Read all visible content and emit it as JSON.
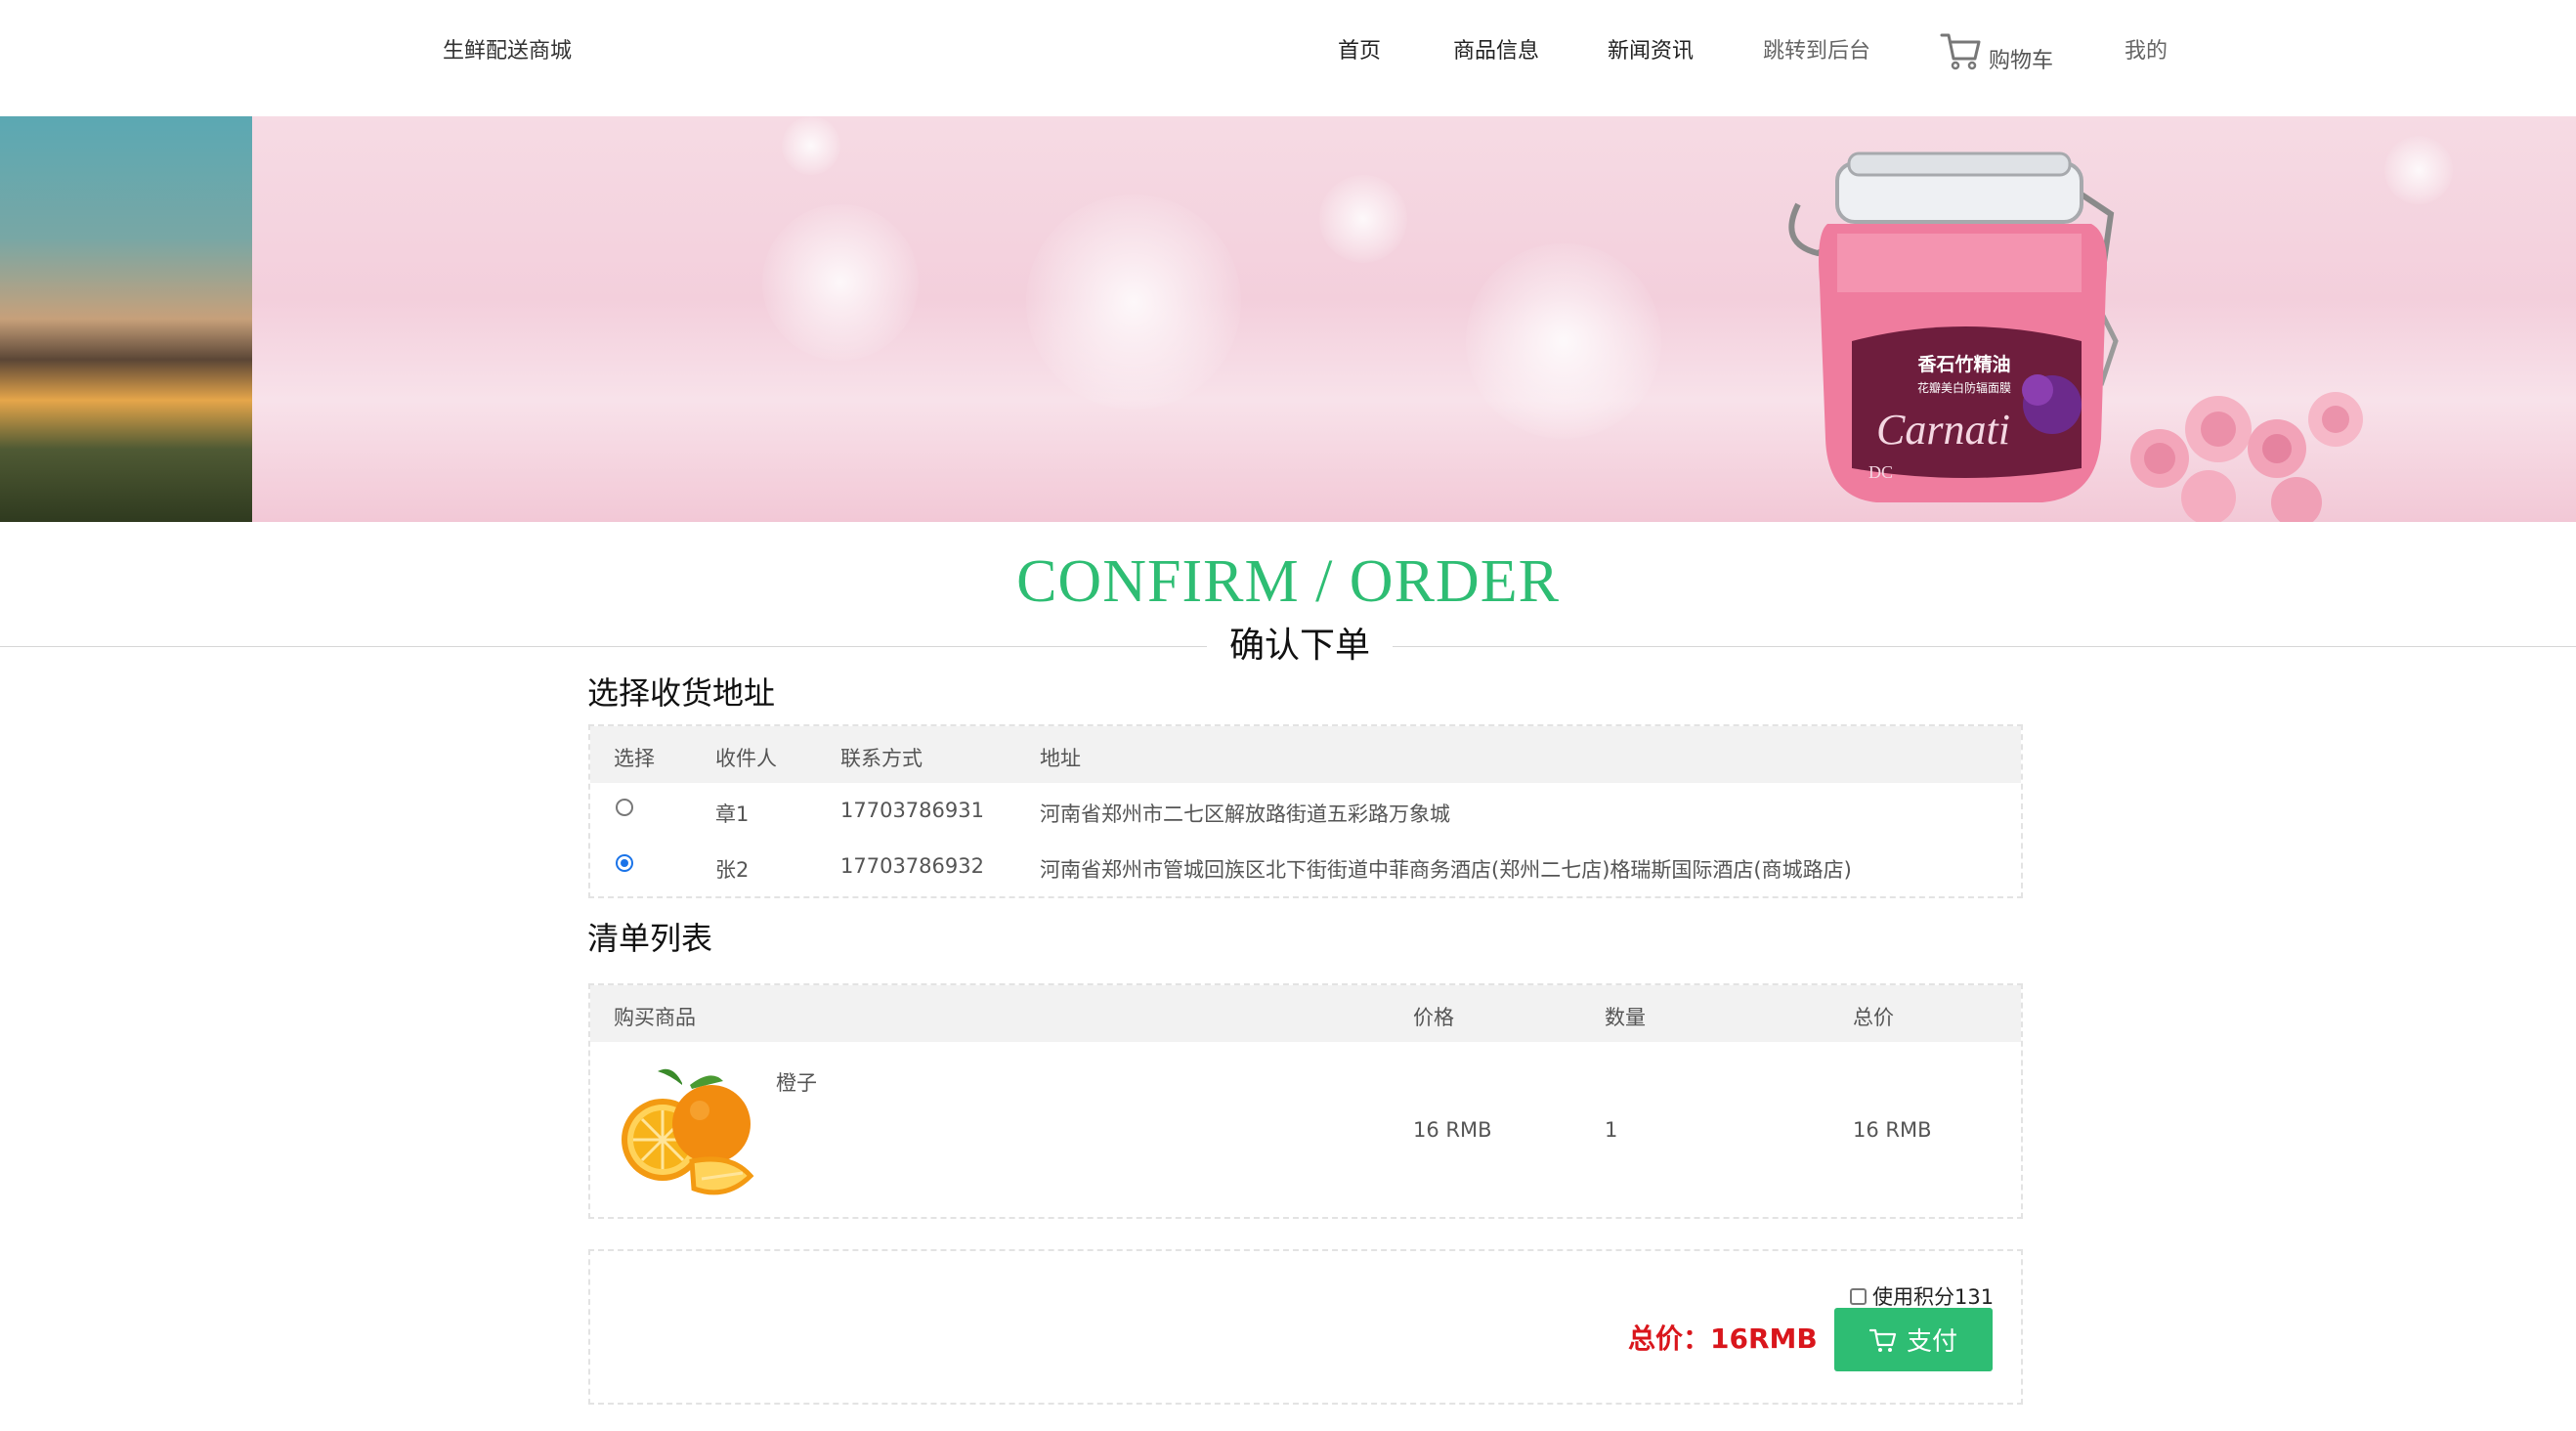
{
  "header": {
    "brand": "生鲜配送商城",
    "nav": [
      "首页",
      "商品信息",
      "新闻资讯",
      "跳转到后台"
    ],
    "cart": "购物车",
    "mine": "我的"
  },
  "banner": {
    "product_text_1": "香石竹精油",
    "product_text_2": "花瓣美白防辐面膜",
    "product_brand": "Carnati",
    "logo_text": "DC"
  },
  "headline": {
    "en": "CONFIRM / ORDER",
    "zh": "确认下单"
  },
  "address_section": {
    "title": "选择收货地址",
    "columns": [
      "选择",
      "收件人",
      "联系方式",
      "地址"
    ],
    "rows": [
      {
        "name": "章1",
        "phone": "17703786931",
        "address": "河南省郑州市二七区解放路街道五彩路万象城",
        "selected": false
      },
      {
        "name": "张2",
        "phone": "17703786932",
        "address": "河南省郑州市管城回族区北下街街道中菲商务酒店(郑州二七店)格瑞斯国际酒店(商城路店)",
        "selected": true
      }
    ]
  },
  "items_section": {
    "title": "清单列表",
    "columns": [
      "购买商品",
      "价格",
      "数量",
      "总价"
    ],
    "items": [
      {
        "name": "橙子",
        "price": "16 RMB",
        "qty": "1",
        "total": "16 RMB",
        "image": "orange-image"
      }
    ]
  },
  "checkout": {
    "points_label": "使用积分131",
    "total": "总价：16RMB",
    "pay": "支付",
    "pay_color": "#2ebd73",
    "total_color": "#d9161c"
  }
}
